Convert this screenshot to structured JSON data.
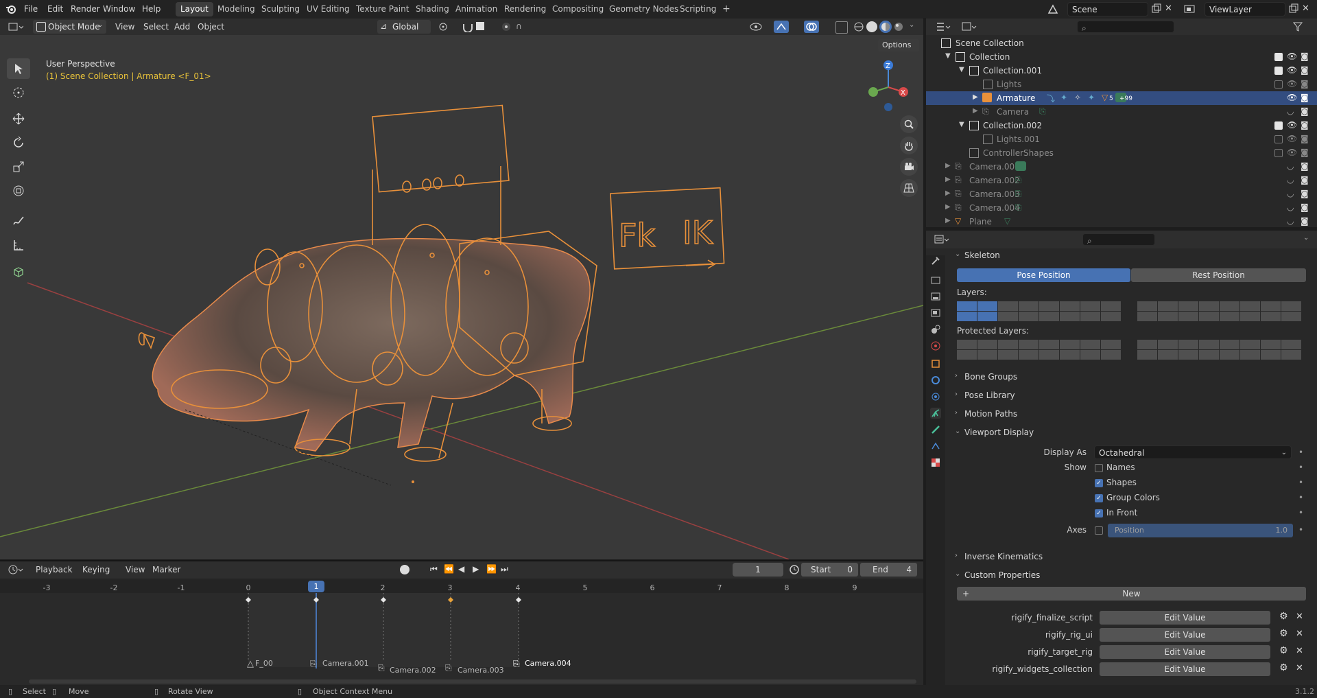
{
  "topbar": {
    "menus": [
      "File",
      "Edit",
      "Render",
      "Window",
      "Help"
    ],
    "workspaces": [
      "Layout",
      "Modeling",
      "Sculpting",
      "UV Editing",
      "Texture Paint",
      "Shading",
      "Animation",
      "Rendering",
      "Compositing",
      "Geometry Nodes",
      "Scripting"
    ],
    "active_workspace": "Layout",
    "add_tab": "+",
    "scene": "Scene",
    "view_layer": "ViewLayer"
  },
  "viewport": {
    "mode": "Object Mode",
    "menus": [
      "View",
      "Select",
      "Add",
      "Object"
    ],
    "orientation": "Global",
    "options_label": "Options",
    "view_name": "User Perspective",
    "context": "(1) Scene Collection | Armature <F_01>",
    "fk_label": "Fk",
    "ik_label": "IK"
  },
  "timeline": {
    "playback": "Playback",
    "keying": "Keying",
    "view": "View",
    "marker": "Marker",
    "current_frame": "1",
    "start_label": "Start",
    "start": "0",
    "end_label": "End",
    "end": "4",
    "ruler": [
      "-3",
      "-2",
      "-1",
      "0",
      "1",
      "2",
      "3",
      "4",
      "5",
      "6",
      "7",
      "8",
      "9"
    ],
    "markers": [
      "F_00",
      "Camera.001",
      "Camera.002",
      "Camera.003",
      "Camera.004"
    ]
  },
  "status": {
    "select": "Select",
    "move": "Move",
    "rotate": "Rotate View",
    "context_menu": "Object Context Menu",
    "version": "3.1.2"
  },
  "outliner": {
    "rows": [
      {
        "label": "Scene Collection"
      },
      {
        "label": "Collection"
      },
      {
        "label": "Collection.001"
      },
      {
        "label": "Lights"
      },
      {
        "label": "Armature",
        "badge": "5",
        "extra": "+99"
      },
      {
        "label": "Camera"
      },
      {
        "label": "Collection.002"
      },
      {
        "label": "Lights.001"
      },
      {
        "label": "ControllerShapes"
      },
      {
        "label": "Camera.001"
      },
      {
        "label": "Camera.002"
      },
      {
        "label": "Camera.003"
      },
      {
        "label": "Camera.004"
      },
      {
        "label": "Plane"
      }
    ]
  },
  "properties": {
    "skeleton": "Skeleton",
    "pose_position": "Pose Position",
    "rest_position": "Rest Position",
    "layers": "Layers:",
    "protected_layers": "Protected Layers:",
    "bone_groups": "Bone Groups",
    "pose_library": "Pose Library",
    "motion_paths": "Motion Paths",
    "viewport_display": "Viewport Display",
    "display_as_label": "Display As",
    "display_as": "Octahedral",
    "show_label": "Show",
    "names": "Names",
    "shapes": "Shapes",
    "group_colors": "Group Colors",
    "in_front": "In Front",
    "axes_label": "Axes",
    "position_label": "Position",
    "position_value": "1.0",
    "inverse_kinematics": "Inverse Kinematics",
    "custom_properties": "Custom Properties",
    "new_label": "New",
    "custom_props": [
      {
        "name": "rigify_finalize_script",
        "button": "Edit Value"
      },
      {
        "name": "rigify_rig_ui",
        "button": "Edit Value"
      },
      {
        "name": "rigify_target_rig",
        "button": "Edit Value"
      },
      {
        "name": "rigify_widgets_collection",
        "button": "Edit Value"
      }
    ]
  },
  "colors": {
    "accent": "#4772b3",
    "selection": "#334d80",
    "rig_orange": "#e8903a"
  }
}
